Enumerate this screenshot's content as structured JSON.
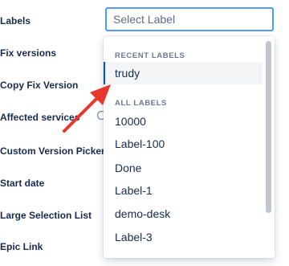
{
  "fields": [
    {
      "name": "labels",
      "label": "Labels"
    },
    {
      "name": "fix-versions",
      "label": "Fix versions"
    },
    {
      "name": "copy-fix-version",
      "label": "Copy Fix Version"
    },
    {
      "name": "affected-services",
      "label": "Affected services"
    },
    {
      "name": "custom-version-picker",
      "label": "Custom Version Picker"
    },
    {
      "name": "start-date",
      "label": "Start date"
    },
    {
      "name": "large-selection-list",
      "label": "Large Selection List"
    },
    {
      "name": "epic-link",
      "label": "Epic Link"
    }
  ],
  "select": {
    "placeholder": "Select Label",
    "value": ""
  },
  "dropdown": {
    "recent_heading": "RECENT LABELS",
    "recent": [
      "trudy"
    ],
    "all_heading": "ALL LABELS",
    "all": [
      "10000",
      "Label-100",
      "Done",
      "Label-1",
      "demo-desk",
      "Label-3"
    ]
  },
  "icons": {
    "help": "help-icon",
    "annotation_arrow": "red-arrow-annotation"
  },
  "colors": {
    "focus_border": "#4c9aff",
    "active_indicator": "#0052cc",
    "arrow": "#e8372c"
  }
}
